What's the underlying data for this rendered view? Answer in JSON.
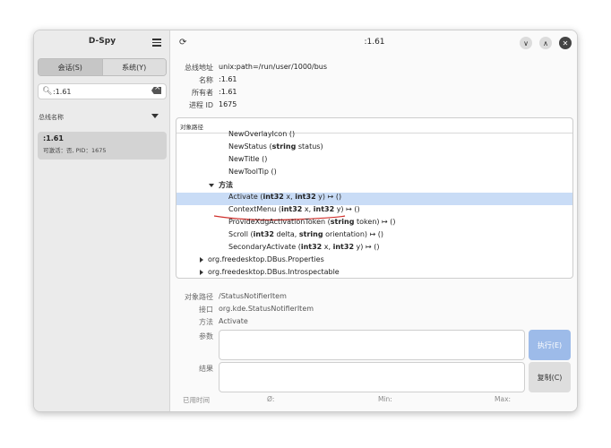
{
  "sidebar": {
    "app_title": "D-Spy",
    "seg_session": "会话(S)",
    "seg_system": "系统(Y)",
    "search_value": ":1.61",
    "bus_names_label": "总线名称",
    "connection": {
      "name": ":1.61",
      "details": "可激活：否, PID：1675"
    }
  },
  "header": {
    "title": ":1.61"
  },
  "info": {
    "address_label": "总线地址",
    "address_value": "unix:path=/run/user/1000/bus",
    "name_label": "名称",
    "name_value": ":1.61",
    "owner_label": "所有者",
    "owner_value": ":1.61",
    "pid_label": "进程 ID",
    "pid_value": "1675"
  },
  "tree": {
    "header": "对象路径",
    "rows": [
      {
        "prefix": "NewOverlayIcon ",
        "bold": "",
        "suffix": "()"
      },
      {
        "prefix": "NewStatus (",
        "bold": "string",
        "suffix": " status)"
      },
      {
        "prefix": "NewTitle ()",
        "bold": "",
        "suffix": ""
      },
      {
        "prefix": "NewToolTip ()",
        "bold": "",
        "suffix": ""
      },
      {
        "prefix": "",
        "bold": "方法",
        "suffix": ""
      },
      {
        "prefix": "Activate (",
        "bold": "int32",
        "suffix": " x, ",
        "bold2": "int32",
        "suffix2": " y) ↦ ()"
      },
      {
        "prefix": "ContextMenu (",
        "bold": "int32",
        "suffix": " x, ",
        "bold2": "int32",
        "suffix2": " y) ↦ ()"
      },
      {
        "prefix": "ProvideXdgActivationToken (",
        "bold": "string",
        "suffix": " token) ↦ ()"
      },
      {
        "prefix": "Scroll (",
        "bold": "int32",
        "suffix": " delta, ",
        "bold2": "string",
        "suffix2": " orientation) ↦ ()"
      },
      {
        "prefix": "SecondaryActivate (",
        "bold": "int32",
        "suffix": " x, ",
        "bold2": "int32",
        "suffix2": " y) ↦ ()"
      },
      {
        "prefix": "org.freedesktop.DBus.Properties",
        "bold": "",
        "suffix": ""
      },
      {
        "prefix": "org.freedesktop.DBus.Introspectable",
        "bold": "",
        "suffix": ""
      }
    ]
  },
  "details": {
    "object_path_label": "对象路径",
    "object_path_value": "/StatusNotifierItem",
    "interface_label": "接口",
    "interface_value": "org.kde.StatusNotifierItem",
    "method_label": "方法",
    "method_value": "Activate",
    "params_label": "参数",
    "result_label": "结果",
    "execute_label": "执行(E)",
    "copy_label": "复制(C)",
    "elapsed_label": "已用时间",
    "avg_label": "Ø:",
    "min_label": "Min:",
    "max_label": "Max:"
  },
  "colors": {
    "selection": "#c9dcf6",
    "execute_button": "#9dbbe9",
    "annotation_line": "#d0312d"
  }
}
